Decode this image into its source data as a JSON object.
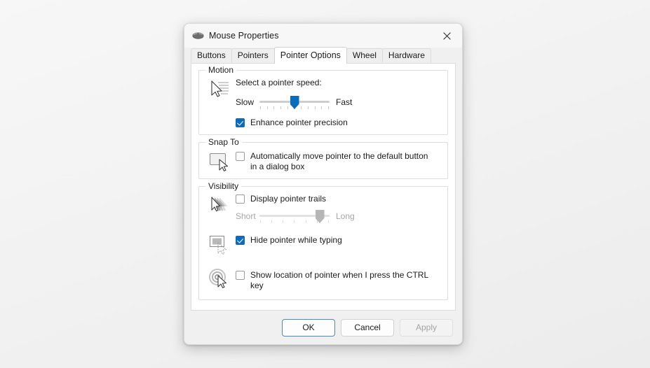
{
  "window": {
    "title": "Mouse Properties",
    "icon": "mouse-icon",
    "close_label": "×",
    "accent_color": "#0a6cbd"
  },
  "tabs": [
    {
      "label": "Buttons",
      "selected": false
    },
    {
      "label": "Pointers",
      "selected": false
    },
    {
      "label": "Pointer Options",
      "selected": true
    },
    {
      "label": "Wheel",
      "selected": false
    },
    {
      "label": "Hardware",
      "selected": false
    }
  ],
  "motion": {
    "group_label": "Motion",
    "icon": "pointer-speed-icon",
    "caption": "Select a pointer speed:",
    "slider": {
      "min_label": "Slow",
      "max_label": "Fast",
      "value_percent": 50,
      "enabled": true,
      "tick_count": 11
    },
    "enhance_precision": {
      "label": "Enhance pointer precision",
      "checked": true
    }
  },
  "snap_to": {
    "group_label": "Snap To",
    "icon": "default-button-icon",
    "auto_move": {
      "label": "Automatically move pointer to the default button in a dialog box",
      "checked": false
    }
  },
  "visibility": {
    "group_label": "Visibility",
    "trails": {
      "icon": "pointer-trails-icon",
      "label": "Display pointer trails",
      "checked": false,
      "slider": {
        "min_label": "Short",
        "max_label": "Long",
        "value_percent": 86,
        "enabled": false,
        "tick_count": 7
      }
    },
    "hide_while_typing": {
      "icon": "hide-pointer-icon",
      "label": "Hide pointer while typing",
      "checked": true
    },
    "show_location": {
      "icon": "ctrl-locate-icon",
      "label": "Show location of pointer when I press the CTRL key",
      "checked": false
    }
  },
  "footer": {
    "ok": "OK",
    "cancel": "Cancel",
    "apply": "Apply",
    "apply_disabled": true
  }
}
